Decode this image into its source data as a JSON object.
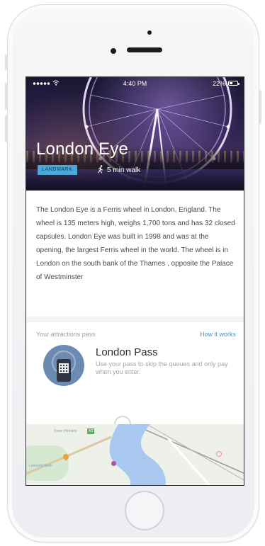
{
  "status_bar": {
    "time": "4:40 PM",
    "battery": "22%"
  },
  "hero": {
    "title": "London Eye",
    "badge": "LANDMARK",
    "walk": "5 min walk"
  },
  "description": "The London Eye is a Ferris wheel in London, England. The wheel is 135 meters high, weighs 1,700 tons and has 32 closed capsules. London Eye was built in 1998 and was at the opening, the largest Ferris wheel in the world. The wheel is in London on the south bank of the Thames , opposite the Palace of Westminster",
  "pass_section": {
    "heading": "Your attractions pass",
    "link": "How it works"
  },
  "pass_card": {
    "title": "London Pass",
    "description": "Use your pass to skip the queues and only pay when you enter."
  },
  "map": {
    "label_1": "Tower Hamlets",
    "label_2": "Lambeth North",
    "road_badge": "A3"
  },
  "colors": {
    "accent": "#3f95c6",
    "badge": "#4aa8d8",
    "river": "#a8c8ef"
  },
  "icons": {
    "wifi": "wifi-icon",
    "battery": "battery-icon",
    "walk": "walking-person-icon",
    "qr": "qr-code-icon",
    "pin": "map-pin-icon"
  }
}
